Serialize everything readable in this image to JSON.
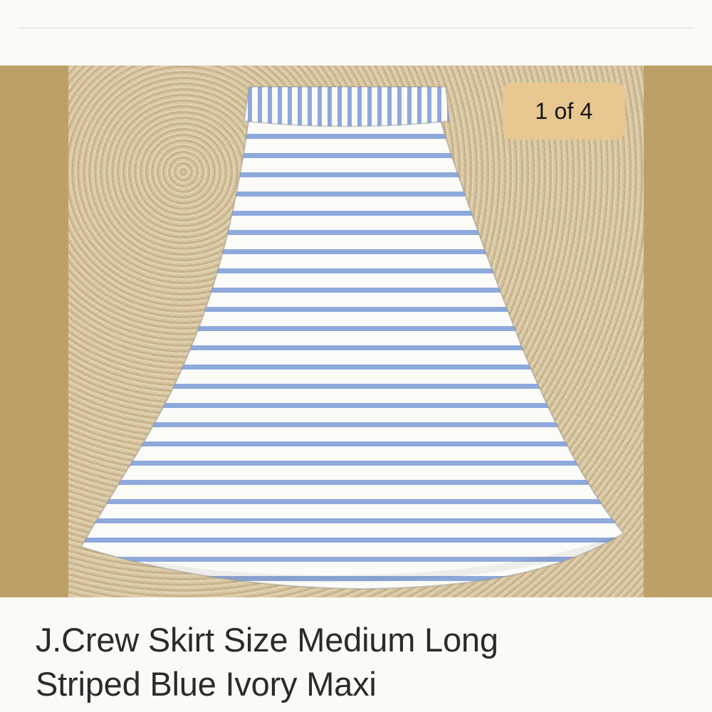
{
  "listing": {
    "title_line_1": "J.Crew Skirt Size Medium Long",
    "title_line_2": "Striped Blue Ivory Maxi"
  },
  "gallery": {
    "counter": "1 of 4",
    "image_subject": "striped skirt photo"
  },
  "colors": {
    "background": "#fbfaf6",
    "gallery_bg": "#bd9f68",
    "badge_bg": "#e8c890",
    "stripe_blue": "#8ea9dc",
    "stripe_ivory": "#fbfbf8"
  }
}
